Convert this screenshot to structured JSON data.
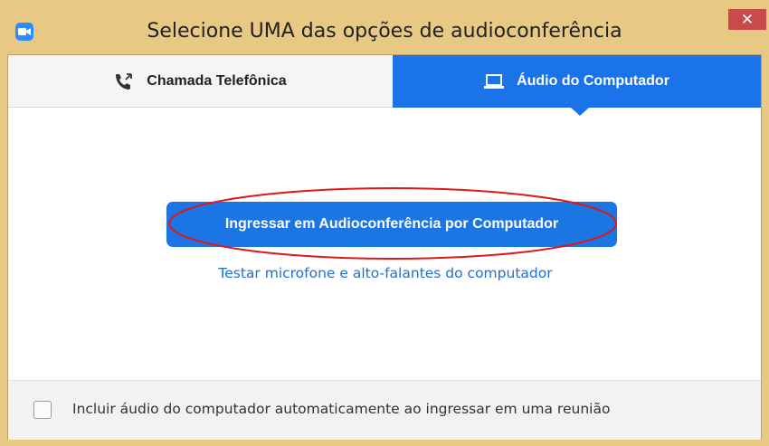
{
  "window": {
    "title": "Selecione UMA das opções de audioconferência",
    "close_glyph": "✕"
  },
  "tabs": [
    {
      "label": "Chamada Telefônica",
      "icon": "phone-icon",
      "selected": false
    },
    {
      "label": "Áudio do Computador",
      "icon": "laptop-icon",
      "selected": true
    }
  ],
  "main": {
    "join_button_label": "Ingressar em Audioconferência por Computador",
    "test_link_label": "Testar microfone e alto-falantes do computador"
  },
  "footer": {
    "checkbox_label": "Incluir áudio do computador automaticamente ao ingressar em uma reunião",
    "checkbox_checked": false
  },
  "colors": {
    "accent": "#1a73e8",
    "highlight": "#e0161b",
    "frame": "#e8c983"
  }
}
